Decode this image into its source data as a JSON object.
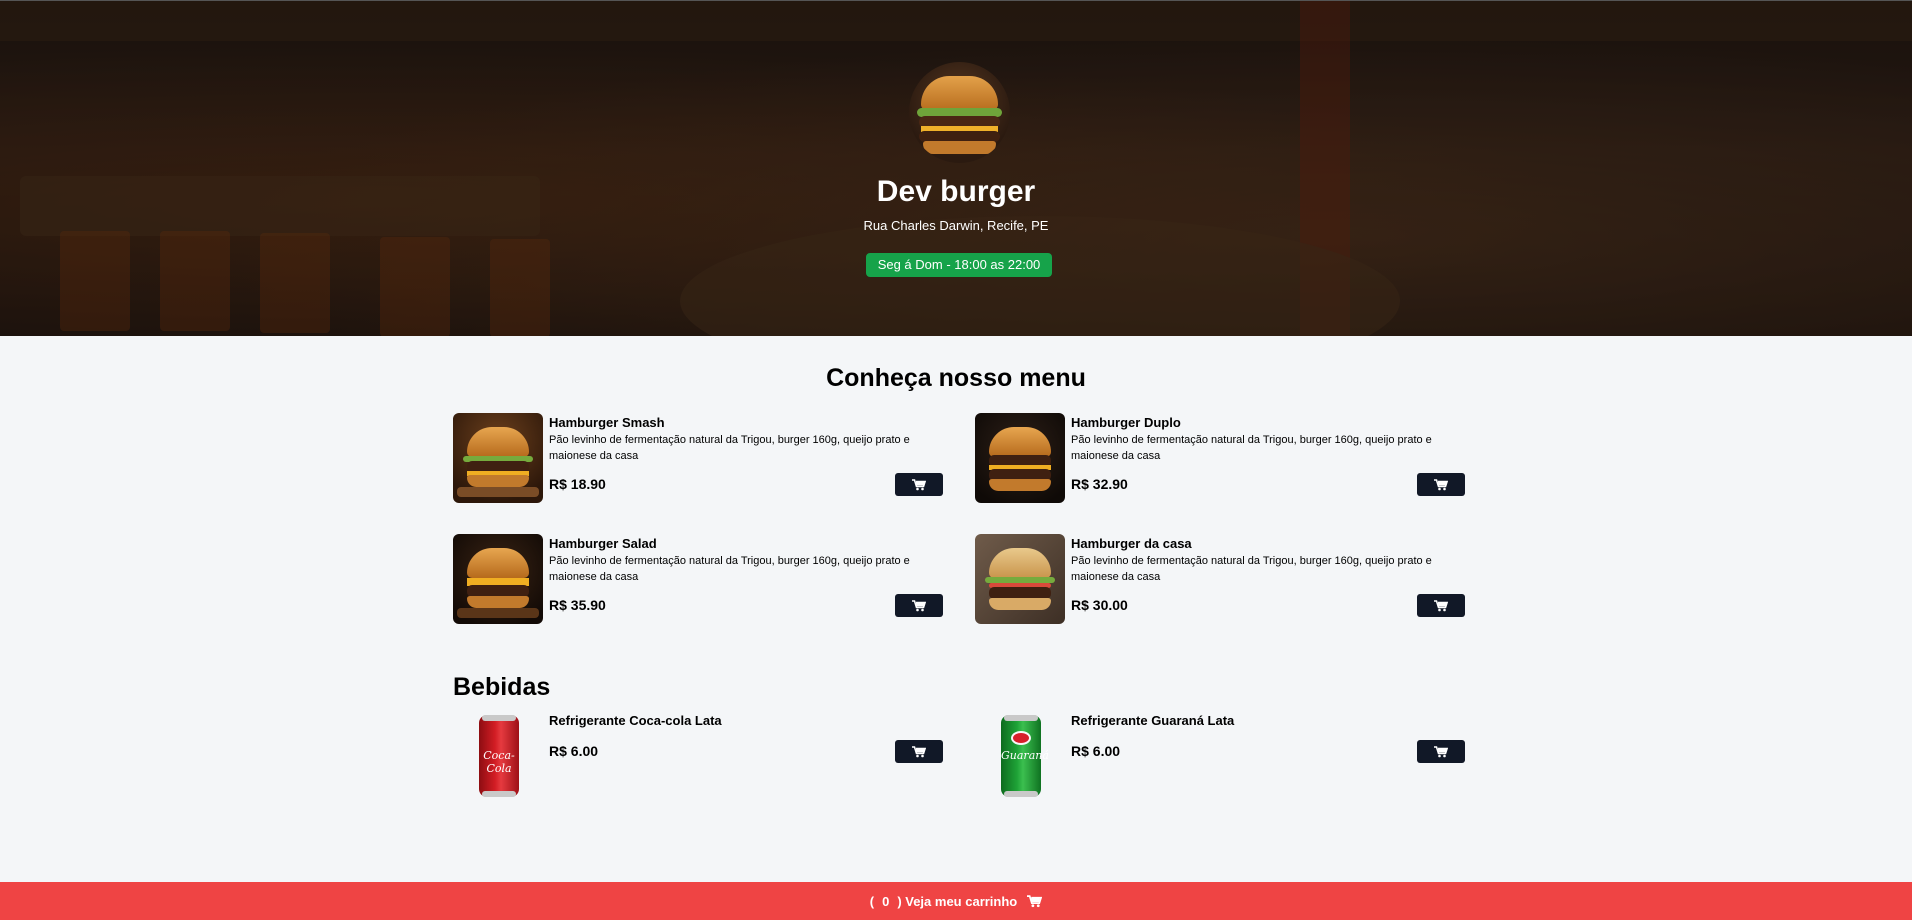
{
  "header": {
    "title": "Dev burger",
    "address": "Rua Charles Darwin, Recife, PE",
    "hours": "Seg á Dom - 18:00 as 22:00"
  },
  "menu": {
    "title": "Conheça nosso menu",
    "burgers": [
      {
        "name": "Hamburger Smash",
        "description": "Pão levinho de fermentação natural da Trigou, burger 160g, queijo prato e maionese da casa",
        "price": "R$ 18.90"
      },
      {
        "name": "Hamburger Duplo",
        "description": "Pão levinho de fermentação natural da Trigou, burger 160g, queijo prato e maionese da casa",
        "price": "R$ 32.90"
      },
      {
        "name": "Hamburger Salad",
        "description": "Pão levinho de fermentação natural da Trigou, burger 160g, queijo prato e maionese da casa",
        "price": "R$ 35.90"
      },
      {
        "name": "Hamburger da casa",
        "description": "Pão levinho de fermentação natural da Trigou, burger 160g, queijo prato e maionese da casa",
        "price": "R$ 30.00"
      }
    ]
  },
  "drinks": {
    "title": "Bebidas",
    "items": [
      {
        "name": "Refrigerante Coca-cola Lata",
        "price": "R$ 6.00",
        "can_text": "Coca-Cola"
      },
      {
        "name": "Refrigerante Guaraná Lata",
        "price": "R$ 6.00",
        "can_text": "Guaraná"
      }
    ]
  },
  "cart": {
    "open_paren": "(",
    "count": "0",
    "label": ") Veja meu carrinho",
    "icon": "cart-icon"
  },
  "colors": {
    "hours_badge": "#16a34a",
    "cart_button": "#111827",
    "footer": "#ef4444"
  }
}
